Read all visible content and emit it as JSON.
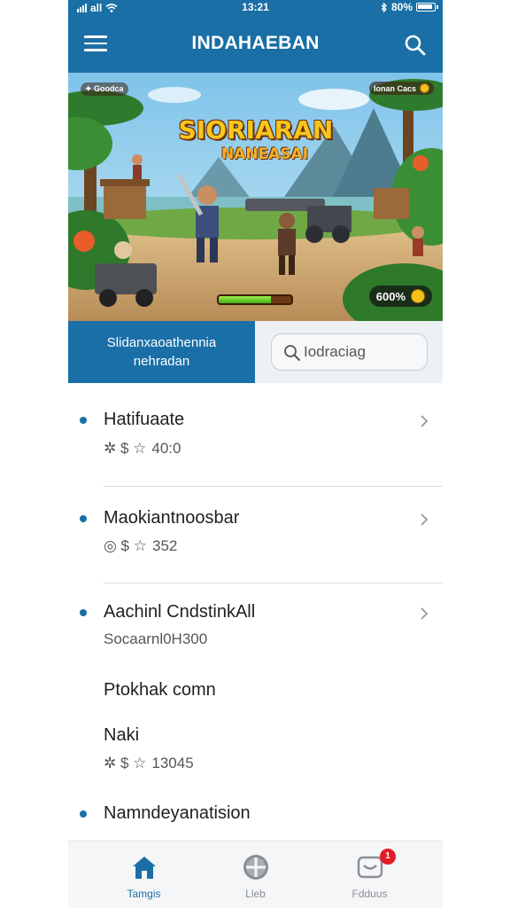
{
  "status": {
    "time": "13:21",
    "carrier": "all",
    "battery": "80%"
  },
  "header": {
    "title": "INDAHAEBAN",
    "menu_icon": "hamburger-icon",
    "search_icon": "search-icon"
  },
  "banner": {
    "title": "SIORIARAN",
    "subtitle": "NANEASAI",
    "chip_left": "Goodca",
    "chip_right": "Ionan Cacs",
    "coins": "600%",
    "progress": 0.72
  },
  "tabs": {
    "active_label_line1": "Slidanxaoathennia",
    "active_label_line2": "nehradan",
    "search_placeholder": "Iodraciag"
  },
  "list": {
    "items": [
      {
        "title": "Hatifuaate",
        "meta_icons": "✲ $ ☆",
        "meta_value": "40:0",
        "chevron": true
      },
      {
        "title": "Maokiantnoosbar",
        "meta_icons": "◎ $ ☆",
        "meta_value": "352",
        "chevron": true
      },
      {
        "title": "Aachinl CndstinkAll",
        "meta_value": "Socaarnl0H300",
        "chevron": true
      },
      {
        "title": "Ptokhak comn"
      },
      {
        "title": "Naki",
        "meta_icons": "✲ $ ☆",
        "meta_value": "13045"
      },
      {
        "title": "Namndeyanatision"
      }
    ]
  },
  "bottom_nav": {
    "items": [
      {
        "label": "Tamgis",
        "icon": "home-icon"
      },
      {
        "label": "Lleb",
        "icon": "plus-circle-icon"
      },
      {
        "label": "Fdduus",
        "icon": "inbox-icon"
      }
    ],
    "badge": "1"
  },
  "colors": {
    "primary": "#1a6fa6",
    "badge": "#e21c23"
  }
}
